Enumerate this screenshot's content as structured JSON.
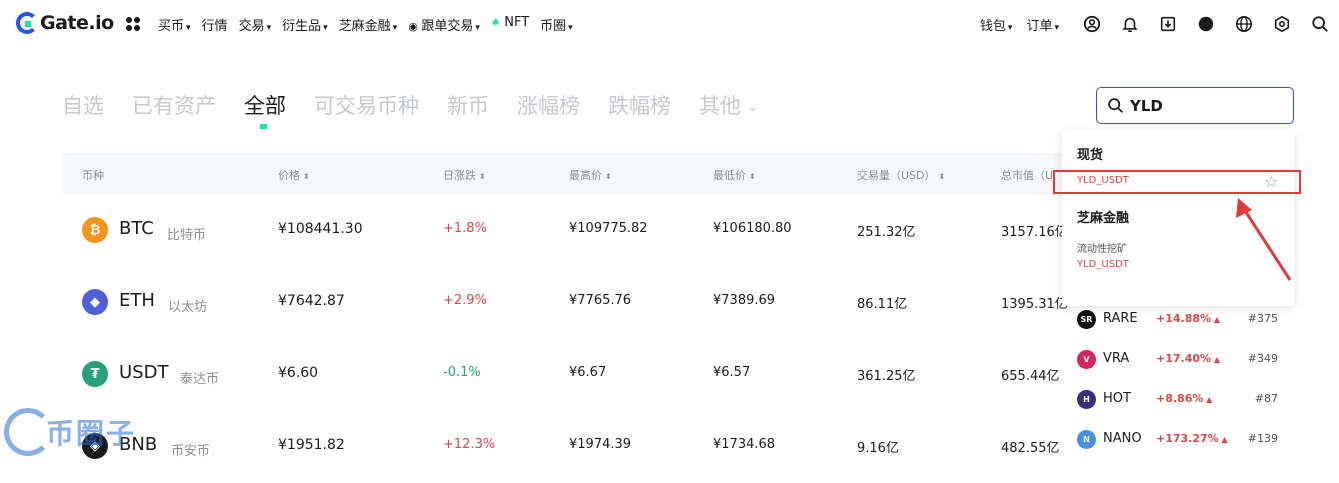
{
  "brand": {
    "logo_text": "Gate.io"
  },
  "nav": {
    "left": [
      {
        "label": "买币",
        "dropdown": true
      },
      {
        "label": "行情",
        "dropdown": false
      },
      {
        "label": "交易",
        "dropdown": true
      },
      {
        "label": "衍生品",
        "dropdown": true
      },
      {
        "label": "芝麻金融",
        "dropdown": true
      },
      {
        "label": "跟单交易",
        "dropdown": true
      },
      {
        "label": "NFT",
        "dropdown": false
      },
      {
        "label": "币圈",
        "dropdown": true
      }
    ],
    "right": [
      {
        "label": "钱包"
      },
      {
        "label": "订单"
      }
    ],
    "icons": [
      "user-icon",
      "bell-icon",
      "download-icon",
      "theme-toggle-icon",
      "globe-icon",
      "settings-icon",
      "search-icon"
    ]
  },
  "tabs": [
    {
      "label": "自选",
      "active": false
    },
    {
      "label": "已有资产",
      "active": false
    },
    {
      "label": "全部",
      "active": true
    },
    {
      "label": "可交易币种",
      "active": false
    },
    {
      "label": "新币",
      "active": false
    },
    {
      "label": "涨幅榜",
      "active": false
    },
    {
      "label": "跌幅榜",
      "active": false
    },
    {
      "label": "其他",
      "active": false
    }
  ],
  "search": {
    "value": "YLD"
  },
  "table": {
    "columns": [
      "币种",
      "价格",
      "日涨跌",
      "最高价",
      "最低价",
      "交易量（USD）",
      "总市值（U"
    ],
    "rows": [
      {
        "icon": "bitcoin-icon",
        "symbol": "BTC",
        "name": "比特币",
        "price": "¥108441.30",
        "change": "+1.8%",
        "dir": "up",
        "high": "¥109775.82",
        "low": "¥106180.80",
        "volume": "251.32亿",
        "cap": "3157.16亿",
        "color": "#f7931a",
        "glyph": "₿"
      },
      {
        "icon": "ethereum-icon",
        "symbol": "ETH",
        "name": "以太坊",
        "price": "¥7642.87",
        "change": "+2.9%",
        "dir": "up",
        "high": "¥7765.76",
        "low": "¥7389.69",
        "volume": "86.11亿",
        "cap": "1395.31亿",
        "color": "#4f5fd6",
        "glyph": "◆"
      },
      {
        "icon": "tether-icon",
        "symbol": "USDT",
        "name": "泰达币",
        "price": "¥6.60",
        "change": "-0.1%",
        "dir": "down",
        "high": "¥6.67",
        "low": "¥6.57",
        "volume": "361.25亿",
        "cap": "655.44亿",
        "color": "#26a17b",
        "glyph": "₮"
      },
      {
        "icon": "bnb-icon",
        "symbol": "BNB",
        "name": "币安币",
        "price": "¥1951.82",
        "change": "+12.3%",
        "dir": "up",
        "high": "¥1974.39",
        "low": "¥1734.68",
        "volume": "9.16亿",
        "cap": "482.55亿",
        "color": "#1b1b1b",
        "glyph": "◈"
      }
    ]
  },
  "dropdown": {
    "spot_heading": "现货",
    "spot_pair": "YLD_USDT",
    "finance_heading": "芝麻金融",
    "finance_sub": "流动性挖矿",
    "finance_pair": "YLD_USDT"
  },
  "gainers": [
    {
      "icon": "rare-icon",
      "glyph": "SR",
      "symbol": "RARE",
      "change": "+14.88%",
      "rank": "#375",
      "color": "#111111"
    },
    {
      "icon": "vra-icon",
      "glyph": "V",
      "symbol": "VRA",
      "change": "+17.40%",
      "rank": "#349",
      "color": "#d8235f"
    },
    {
      "icon": "hot-icon",
      "glyph": "H",
      "symbol": "HOT",
      "change": "+8.86%",
      "rank": "#87",
      "color": "#3b2d79"
    },
    {
      "icon": "nano-icon",
      "glyph": "N",
      "symbol": "NANO",
      "change": "+173.27%",
      "rank": "#139",
      "color": "#4a90e2"
    }
  ],
  "watermark": {
    "text": "币圈子"
  },
  "colors": {
    "accent": "#2354e6",
    "green": "#17e6a1",
    "up": "#e04545",
    "down": "#1fa97c",
    "highlight": "#e03a3a"
  }
}
